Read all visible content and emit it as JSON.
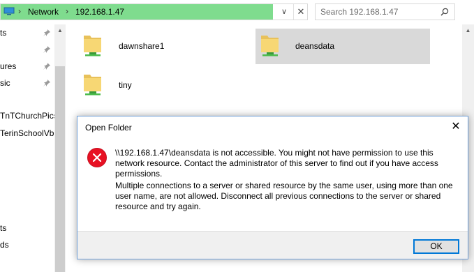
{
  "address": {
    "crumbs": [
      "Network",
      "192.168.1.47"
    ],
    "separator": "›",
    "dropdown_glyph": "∨",
    "close_glyph": "✕",
    "fill_color": "#7fdc8e"
  },
  "search": {
    "placeholder": "Search 192.168.1.47",
    "icon": "search-icon"
  },
  "nav": {
    "items": [
      {
        "label": "ts",
        "pinned": true
      },
      {
        "label": "",
        "pinned": true
      },
      {
        "label": "ures",
        "pinned": true
      },
      {
        "label": "sic",
        "pinned": true
      },
      {
        "label": "TnTChurchPics",
        "pinned": false
      },
      {
        "label": "TerinSchoolVb",
        "pinned": false
      },
      {
        "label": "ts",
        "pinned": false
      },
      {
        "label": "ds",
        "pinned": false
      }
    ]
  },
  "folders": [
    {
      "name": "dawnshare1",
      "selected": false
    },
    {
      "name": "deansdata",
      "selected": true
    },
    {
      "name": "tiny",
      "selected": false
    }
  ],
  "dialog": {
    "title": "Open Folder",
    "close_glyph": "✕",
    "message1": "\\\\192.168.1.47\\deansdata is not accessible. You might not have permission to use this network resource. Contact the administrator of this server to find out if you have access permissions.",
    "message2": "Multiple connections to a server or shared resource by the same user, using more than one user name, are not allowed. Disconnect all previous connections to the server or shared resource and try again.",
    "ok_label": "OK",
    "error_color": "#e81123"
  }
}
